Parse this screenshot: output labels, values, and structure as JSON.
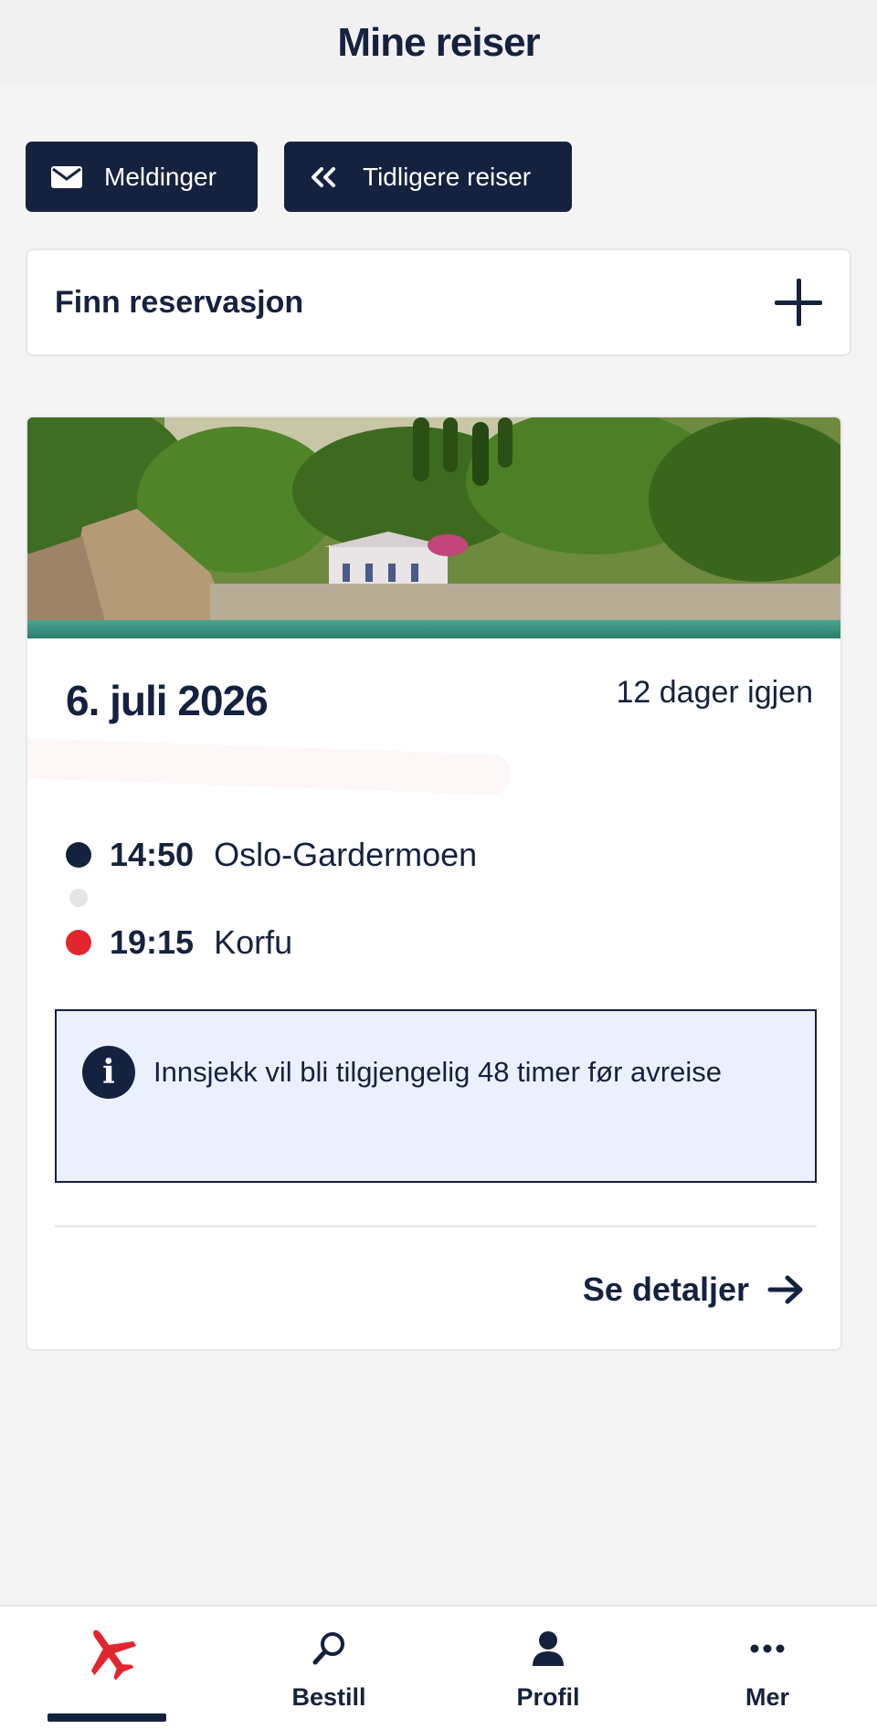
{
  "header": {
    "title": "Mine reiser"
  },
  "actions": {
    "messages_label": "Meldinger",
    "messages_icon": "envelope-icon",
    "previous_label": "Tidligere reiser",
    "previous_icon": "double-chevron-left-icon"
  },
  "find_reservation": {
    "label": "Finn reservasjon",
    "icon": "plus-icon"
  },
  "trip": {
    "image": "Coastal photo: green cypress trees on a hillside above a white house and stone quay by turquoise water",
    "date": "6. juli 2026",
    "days_left": "12 dager igjen",
    "departure": {
      "time": "14:50",
      "place": "Oslo-Gardermoen"
    },
    "arrival": {
      "time": "19:15",
      "place": "Korfu"
    },
    "info": {
      "icon": "info-icon",
      "text": "Innsjekk vil bli tilgjengelig 48 timer før avreise"
    },
    "details_label": "Se detaljer",
    "details_icon": "arrow-right-icon"
  },
  "colors": {
    "navy": "#15223f",
    "red": "#e22630",
    "info_bg": "#eaf1fc",
    "page_bg": "#f4f4f4"
  },
  "bottom_nav": {
    "items": [
      {
        "label": "",
        "icon": "airplane-icon",
        "active": true
      },
      {
        "label": "Bestill",
        "icon": "search-icon",
        "active": false
      },
      {
        "label": "Profil",
        "icon": "person-icon",
        "active": false
      },
      {
        "label": "Mer",
        "icon": "more-dots-icon",
        "active": false
      }
    ]
  }
}
